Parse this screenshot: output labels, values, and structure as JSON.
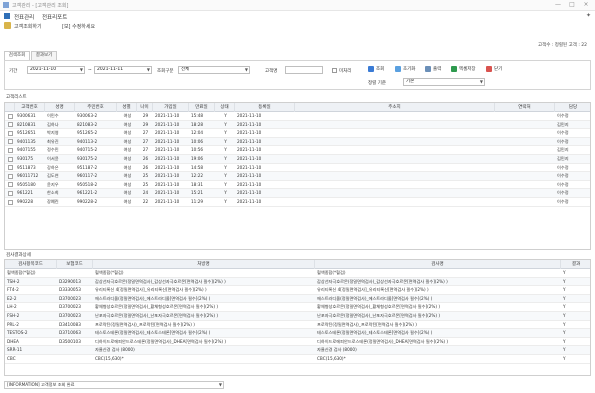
{
  "window": {
    "title": "고객관리 - [고객관리 조회]",
    "controls": [
      "—",
      "□",
      "×"
    ]
  },
  "menu": {
    "items": [
      "전표관리",
      "전표리포트"
    ],
    "pin": "✦"
  },
  "breadcrumb": [
    "고객조회하기",
    "[보] 수정하세요"
  ],
  "top_right": "고객수 : 정렬된 고객 : 22",
  "tabs": [
    "검색조회",
    "결과보기"
  ],
  "filter": {
    "period_label": "기간",
    "date_from": "2021-11-10",
    "date_to": "2021-11-11",
    "type_label": "조회구분",
    "type_value": "전체",
    "name_label": "고객명",
    "name_value": "",
    "check_label": "미처리",
    "buttons": {
      "search": "조회",
      "reset": "초기화",
      "print": "출력",
      "excel": "엑셀저장",
      "close": "닫기"
    },
    "sort_label": "정렬 기준",
    "sort_value": "기본"
  },
  "grid1": {
    "section_label": "고객리스트",
    "columns": [
      "",
      "고객번호",
      "성명",
      "주민번호",
      "성별",
      "나이",
      "가입일",
      "만료일",
      "상태",
      "등록일",
      "주소지",
      "연락처",
      "담당"
    ],
    "rows": [
      [
        "9300631",
        "이민수",
        "930063-2",
        "여성",
        "29",
        "2021-11-10",
        "15:48",
        "Y",
        "2021-11-10",
        "",
        "",
        "이수정"
      ],
      [
        "8210831",
        "김하나",
        "821083-2",
        "여성",
        "29",
        "2021-11-10",
        "18:28",
        "Y",
        "2021-11-10",
        "",
        "",
        "김민지"
      ],
      [
        "9512651",
        "박지영",
        "951265-2",
        "여성",
        "27",
        "2021-11-10",
        "12:04",
        "Y",
        "2021-11-10",
        "",
        "",
        "이수정"
      ],
      [
        "9401135",
        "최유진",
        "940113-2",
        "여성",
        "27",
        "2021-11-10",
        "10:06",
        "Y",
        "2021-11-10",
        "",
        "",
        "이수정"
      ],
      [
        "9407155",
        "정수민",
        "940715-2",
        "여성",
        "27",
        "2021-11-10",
        "10:56",
        "Y",
        "2021-11-10",
        "",
        "",
        "김민지"
      ],
      [
        "930175",
        "이서윤",
        "930175-2",
        "여성",
        "26",
        "2021-11-10",
        "19:06",
        "Y",
        "2021-11-10",
        "",
        "",
        "김민지"
      ],
      [
        "9511873",
        "강하은",
        "951187-2",
        "여성",
        "26",
        "2021-11-10",
        "14:58",
        "Y",
        "2021-11-10",
        "",
        "",
        "이수정"
      ],
      [
        "96011712",
        "김도연",
        "960117-2",
        "여성",
        "25",
        "2021-11-10",
        "12:22",
        "Y",
        "2021-11-10",
        "",
        "",
        "이수정"
      ],
      [
        "9505180",
        "윤지우",
        "950518-2",
        "여성",
        "25",
        "2021-11-10",
        "18:31",
        "Y",
        "2021-11-10",
        "",
        "",
        "이수정"
      ],
      [
        "961221",
        "한소희",
        "961221-2",
        "여성",
        "24",
        "2021-11-10",
        "15:21",
        "Y",
        "2021-11-10",
        "",
        "",
        "이수정"
      ],
      [
        "990228",
        "장예린",
        "990228-2",
        "여성",
        "22",
        "2021-11-10",
        "11:29",
        "Y",
        "2021-11-10",
        "",
        "",
        "이수정"
      ]
    ]
  },
  "grid2": {
    "section_label": "검사결과상세",
    "columns": [
      "검사항목코드",
      "보험코드",
      "처방명",
      "검사명",
      "결과"
    ],
    "rows": [
      [
        "혈액종합(*혈검)",
        "",
        "혈액종합(*혈검)",
        "혈액종합(*혈검)",
        "Y"
      ],
      [
        "TSH-2",
        "D3290013",
        "갑상선자극호르몬(정밀면역검사)_갑상선자극호르몬[면역검사 필수](2%) )",
        "갑상선자극호르몬(정밀면역검사)_갑상선자극호르몬[면역검사 필수](2%) )",
        "Y"
      ],
      [
        "FT4-2",
        "D3330053",
        "유리티록신 4[정밀면역검사]_유리티록신[면역검사 필수](2%) )",
        "유리티록신 4[정밀면역검사]_유리티록신[면역검사 필수](2%) )",
        "Y"
      ],
      [
        "E2-2",
        "D3700023",
        "에스트라디올(정밀면역검사)_에스트라디올[면역검사 필수](2%) )",
        "에스트라디올(정밀면역검사)_에스트라디올[면역검사 필수](2%) )",
        "Y"
      ],
      [
        "LH-2",
        "D3700023",
        "황체형성호르몬(정밀면역검사)_황체형성호르몬[면역검사 필수](2%) )",
        "황체형성호르몬(정밀면역검사)_황체형성호르몬[면역검사 필수](2%) )",
        "Y"
      ],
      [
        "FSH-2",
        "D3700023",
        "난포자극호르몬(정밀면역검사)_난포자극호르몬[면역검사 필수](2%) )",
        "난포자극호르몬(정밀면역검사)_난포자극호르몬[면역검사 필수](2%) )",
        "Y"
      ],
      [
        "PRL-2",
        "D3410083",
        "프로락틴(정밀면역검사)_프로락틴[면역검사 필수](2%) )",
        "프로락틴(정밀면역검사)_프로락틴[면역검사 필수](2%) )",
        "Y"
      ],
      [
        "TESTOS-2",
        "D3710063",
        "테스토스테론(정밀면역검사)_테스토스테론[면역검사 필수](2%) )",
        "테스토스테론(정밀면역검사)_테스토스테론[면역검사 필수](2%) )",
        "Y"
      ],
      [
        "DHEA",
        "D3500103",
        "디하이드로에피안드로스테론(정밀면역검사)_DHEA[면역검사 필수](2%) )",
        "디하이드로에피안드로스테론(정밀면역검사)_DHEA[면역검사 필수](2%) )",
        "Y"
      ],
      [
        "SRR-11",
        "",
        "자율신경 검사 (8000)",
        "자율신경 검사 (8000)",
        "Y"
      ],
      [
        "CBC",
        "",
        "CBC(15,630)*",
        "CBC(15,630)*",
        "Y"
      ]
    ]
  },
  "statusbar": {
    "value": "[INFORMATION] 고객정보 조회 완료"
  },
  "colors": {
    "accent": "#2f6fb7",
    "header_bg": "#eef1f5"
  }
}
